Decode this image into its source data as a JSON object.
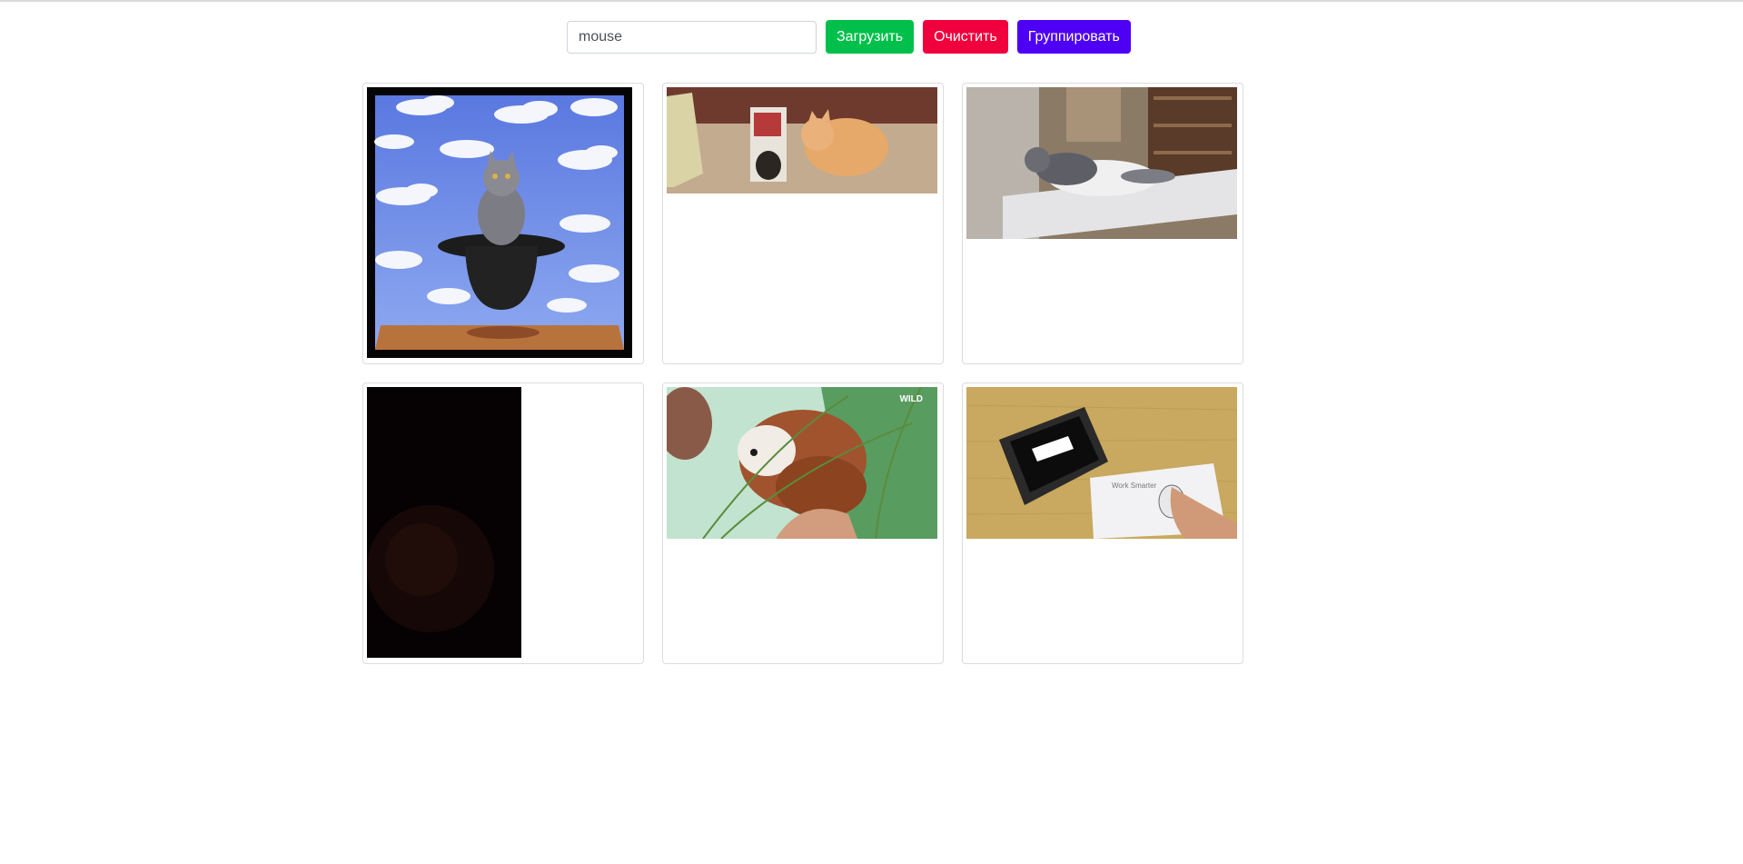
{
  "search": {
    "value": "mouse"
  },
  "toolbar": {
    "load_label": "Загрузить",
    "clear_label": "Очистить",
    "group_label": "Группировать"
  },
  "colors": {
    "load": "#00c04b",
    "clear": "#f0003c",
    "group": "#4e00f5"
  },
  "gallery": {
    "items": [
      {
        "subject": "cat-in-bowler-hat-painting"
      },
      {
        "subject": "kitten-in-juice-box-with-cat"
      },
      {
        "subject": "cat-jumping-on-table"
      },
      {
        "subject": "dark-video-frame"
      },
      {
        "subject": "spaniel-dog-in-grass",
        "watermark": "WILD"
      },
      {
        "subject": "hand-with-mouse-and-tablet",
        "overlay_text": "Work Smarter"
      }
    ]
  }
}
